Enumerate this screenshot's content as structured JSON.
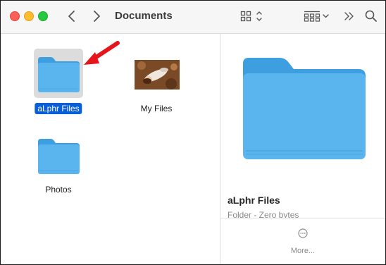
{
  "window": {
    "title": "Documents"
  },
  "toolbar": {
    "back_icon": "chevron-left-icon",
    "forward_icon": "chevron-right-icon",
    "view_icon": "grid-view-icon",
    "group_icon": "group-grid-icon",
    "more_icon": "double-chevron-icon",
    "search_icon": "search-icon"
  },
  "files": [
    {
      "name": "aLphr Files",
      "kind": "folder",
      "selected": true
    },
    {
      "name": "My Files",
      "kind": "image",
      "selected": false
    },
    {
      "name": "Photos",
      "kind": "folder",
      "selected": false
    }
  ],
  "annotation": {
    "color": "#e8141c"
  },
  "preview": {
    "name": "aLphr Files",
    "subtitle": "Folder - Zero bytes",
    "more_label": "More..."
  },
  "colors": {
    "folder": "#5ab4ee",
    "selection": "#0a5fd6"
  }
}
